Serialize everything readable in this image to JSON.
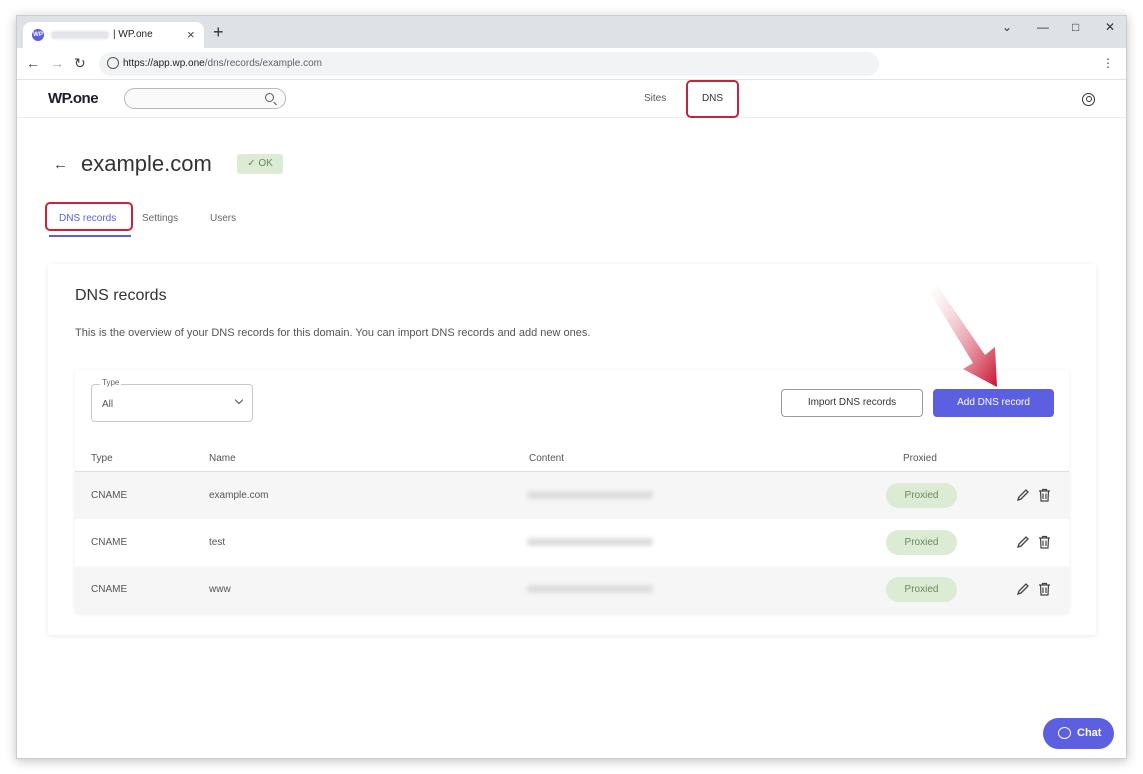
{
  "browser": {
    "tab_title": "| WP.one",
    "favicon": "WP",
    "new_tab": "+",
    "close_tab": "×",
    "url_host": "https://app.wp.one",
    "url_path": "/dns/records/example.com"
  },
  "header": {
    "logo": "WP.one",
    "nav": {
      "sites": "Sites",
      "dns": "DNS"
    }
  },
  "page": {
    "back": "←",
    "domain": "example.com",
    "status": "✓ OK",
    "tabs": {
      "dns_records": "DNS records",
      "settings": "Settings",
      "users": "Users"
    }
  },
  "card": {
    "title": "DNS records",
    "description": "This is the overview of your DNS records for this domain. You can import DNS records and add new ones.",
    "filter": {
      "legend": "Type",
      "value": "All"
    },
    "import_button": "Import DNS records",
    "add_button": "Add DNS record",
    "columns": {
      "type": "Type",
      "name": "Name",
      "content": "Content",
      "proxied": "Proxied"
    },
    "rows": [
      {
        "type": "CNAME",
        "name": "example.com",
        "proxied": "Proxied"
      },
      {
        "type": "CNAME",
        "name": "test",
        "proxied": "Proxied"
      },
      {
        "type": "CNAME",
        "name": "www",
        "proxied": "Proxied"
      }
    ]
  },
  "chat": {
    "label": "Chat"
  },
  "colors": {
    "accent": "#5b5fe0",
    "highlight": "#c6243c",
    "badge_bg": "#dcebd4"
  }
}
